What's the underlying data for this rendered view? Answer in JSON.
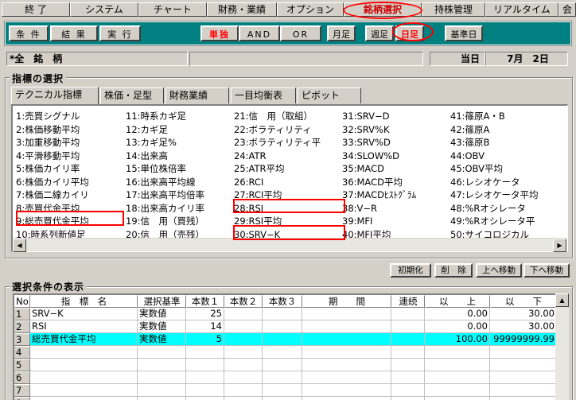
{
  "menu": [
    {
      "label": "終 了"
    },
    {
      "label": "システム"
    },
    {
      "label": "チャート"
    },
    {
      "label": "財務・業績"
    },
    {
      "label": "オプション"
    },
    {
      "label": "銘柄選択"
    },
    {
      "label": "持株管理"
    },
    {
      "label": "リアルタイム"
    },
    {
      "label": "会"
    }
  ],
  "toolbar": [
    {
      "label": "条 件"
    },
    {
      "label": "結 果"
    },
    {
      "label": "実 行"
    },
    {
      "label": "単独"
    },
    {
      "label": "AND"
    },
    {
      "label": "OR"
    },
    {
      "label": "月足"
    },
    {
      "label": "週足"
    },
    {
      "label": "日足"
    },
    {
      "label": "基準日"
    }
  ],
  "info": {
    "universe": "*全　銘　柄",
    "blank": "",
    "today_label": "当日",
    "date": "7月　2日"
  },
  "indicator_group": {
    "title": "指標の選択",
    "tabs": [
      "テクニカル指標",
      "株価・足型",
      "財務業績",
      "一目均衡表",
      "ピボット"
    ]
  },
  "indicators": [
    [
      "1:売買シグナル",
      "2:株価移動平均",
      "3:加重移動平均",
      "4:平滑移動平均",
      "5:株価カイリ率",
      "6:株価カイリ平均",
      "7:株価二線カイリ",
      "8:売買代金平均",
      "9:総売買代金平均",
      "10:時系列新値足"
    ],
    [
      "11:時系カギ足",
      "12:カギ足",
      "13:カギ足%",
      "14:出来高",
      "15:単位株倍率",
      "16:出来高平均線",
      "17:出来高平均倍率",
      "18:出来高カイリ率",
      "19:信　用（買残）",
      "20:信　用（売残）"
    ],
    [
      "21:信　用（取組）",
      "22:ボラティリティ",
      "23:ボラティリティ平",
      "24:ATR",
      "25:ATR平均",
      "26:RCI",
      "27:RCI平均",
      "28:RSI",
      "29:RSI平均",
      "30:SRV−K"
    ],
    [
      "31:SRV−D",
      "32:SRV%K",
      "33:SRV%D",
      "34:SLOW%D",
      "35:MACD",
      "36:MACD平均",
      "37:MACDﾋｽﾄｸﾞﾗﾑ",
      "38:V−R",
      "39:MFI",
      "40:MFI平均"
    ],
    [
      "41:篠原A・B",
      "42:篠原A",
      "43:篠原B",
      "44:OBV",
      "45:OBV平均",
      "46:レシオケータ",
      "47:レシオケータ平均",
      "48:%Rオシレータ",
      "49:%Rオシレータ平",
      "50:サイコロジカル"
    ]
  ],
  "actions": [
    {
      "label": "初期化"
    },
    {
      "label": "削　除"
    },
    {
      "label": "上へ移動"
    },
    {
      "label": "下へ移動"
    }
  ],
  "condition_group": {
    "title": "選択条件の表示"
  },
  "table": {
    "headers": [
      "No",
      "指　標　名",
      "選択基準",
      "本数１",
      "本数２",
      "本数３",
      "期　　間",
      "連続",
      "以　　上",
      "以　　下"
    ],
    "rows": [
      [
        "1",
        "SRV−K",
        "実数値",
        "25",
        "",
        "",
        "",
        "",
        "0.00",
        "30.00"
      ],
      [
        "2",
        "RSI",
        "実数値",
        "14",
        "",
        "",
        "",
        "",
        "0.00",
        "30.00"
      ],
      [
        "3",
        "総売買代金平均",
        "実数値",
        "5",
        "",
        "",
        "",
        "",
        "100.00",
        "99999999.99"
      ],
      [
        "4",
        "",
        "",
        "",
        "",
        "",
        "",
        "",
        "",
        ""
      ],
      [
        "5",
        "",
        "",
        "",
        "",
        "",
        "",
        "",
        "",
        ""
      ],
      [
        "6",
        "",
        "",
        "",
        "",
        "",
        "",
        "",
        "",
        ""
      ],
      [
        "7",
        "",
        "",
        "",
        "",
        "",
        "",
        "",
        "",
        ""
      ],
      [
        "8",
        "",
        "",
        "",
        "",
        "",
        "",
        "",
        "",
        ""
      ]
    ],
    "highlight_row": 3,
    "highlight_color": "#00ffff"
  },
  "colors": {
    "toolbar_bg": "#008080",
    "annotation": "#ff0000",
    "active_red_text": "#ff0000"
  }
}
